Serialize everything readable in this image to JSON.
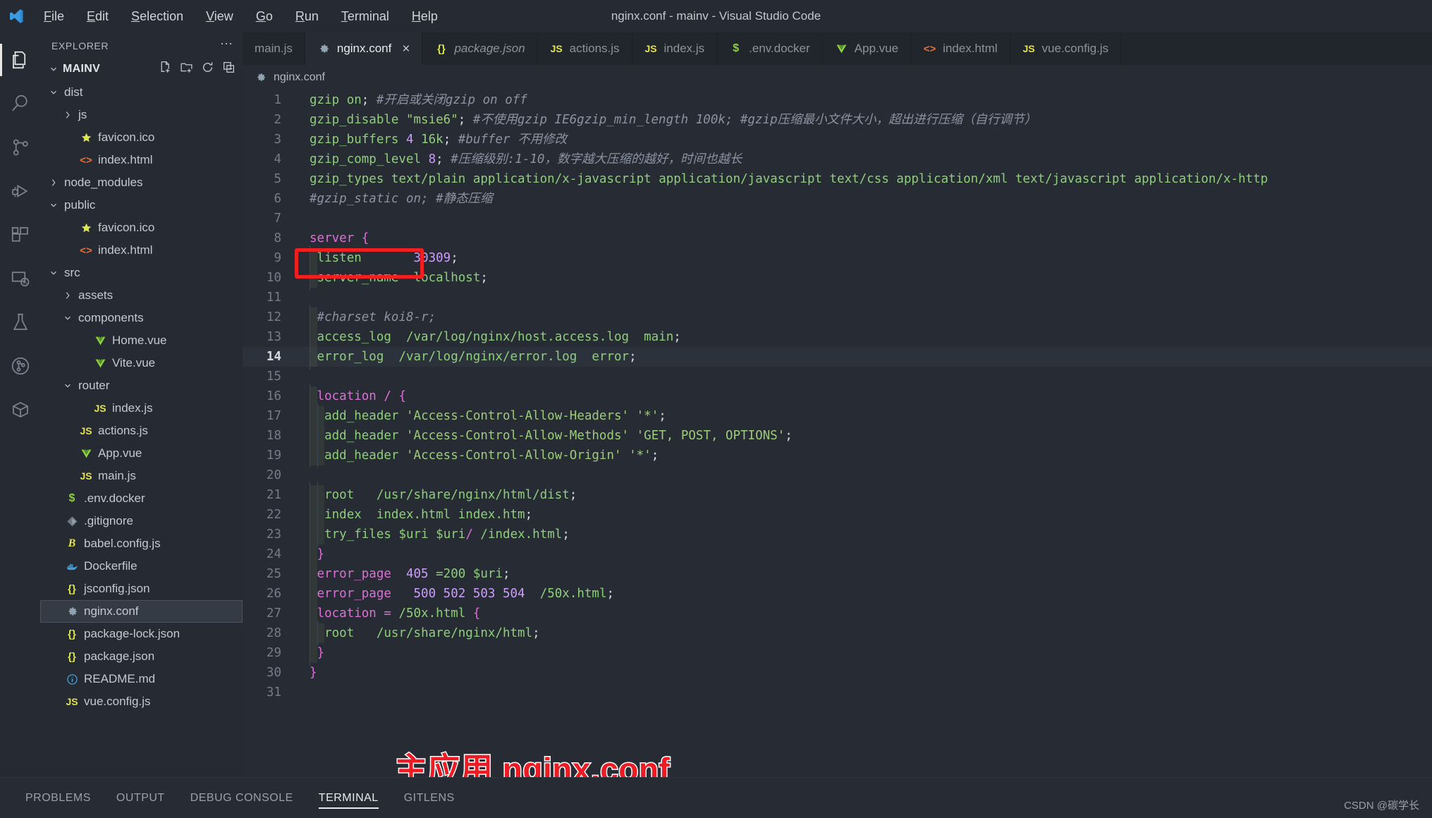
{
  "window": {
    "title": "nginx.conf - mainv - Visual Studio Code",
    "logo_icon": "vscode-logo-icon"
  },
  "menubar": {
    "items": [
      {
        "label": "File",
        "accel": "F"
      },
      {
        "label": "Edit",
        "accel": "E"
      },
      {
        "label": "Selection",
        "accel": "S"
      },
      {
        "label": "View",
        "accel": "V"
      },
      {
        "label": "Go",
        "accel": "G"
      },
      {
        "label": "Run",
        "accel": "R"
      },
      {
        "label": "Terminal",
        "accel": "T"
      },
      {
        "label": "Help",
        "accel": "H"
      }
    ]
  },
  "activitybar": {
    "items": [
      {
        "name": "explorer-icon",
        "label": "Explorer",
        "active": true
      },
      {
        "name": "search-icon",
        "label": "Search",
        "active": false
      },
      {
        "name": "source-control-icon",
        "label": "Source Control",
        "active": false
      },
      {
        "name": "run-debug-icon",
        "label": "Run and Debug",
        "active": false
      },
      {
        "name": "extensions-icon",
        "label": "Extensions",
        "active": false
      },
      {
        "name": "remote-explorer-icon",
        "label": "Remote Explorer",
        "active": false
      },
      {
        "name": "testing-icon",
        "label": "Testing",
        "active": false
      },
      {
        "name": "gitlens-icon",
        "label": "GitLens",
        "active": false
      },
      {
        "name": "package-icon",
        "label": "Package",
        "active": false
      }
    ]
  },
  "sidebar": {
    "title": "EXPLORER",
    "overflow_label": "⋯",
    "folder": "MAINV",
    "actions": [
      "new-file-icon",
      "new-folder-icon",
      "refresh-icon",
      "collapse-all-icon"
    ],
    "tree": [
      {
        "label": "dist",
        "indent": 1,
        "kind": "folder",
        "expanded": true
      },
      {
        "label": "js",
        "indent": 2,
        "kind": "folder",
        "expanded": false
      },
      {
        "label": "favicon.ico",
        "indent": 2,
        "kind": "file",
        "icon": "star-icon"
      },
      {
        "label": "index.html",
        "indent": 2,
        "kind": "file",
        "icon": "html-icon"
      },
      {
        "label": "node_modules",
        "indent": 1,
        "kind": "folder",
        "expanded": false
      },
      {
        "label": "public",
        "indent": 1,
        "kind": "folder",
        "expanded": true
      },
      {
        "label": "favicon.ico",
        "indent": 2,
        "kind": "file",
        "icon": "star-icon"
      },
      {
        "label": "index.html",
        "indent": 2,
        "kind": "file",
        "icon": "html-icon"
      },
      {
        "label": "src",
        "indent": 1,
        "kind": "folder",
        "expanded": true
      },
      {
        "label": "assets",
        "indent": 2,
        "kind": "folder",
        "expanded": false
      },
      {
        "label": "components",
        "indent": 2,
        "kind": "folder",
        "expanded": true
      },
      {
        "label": "Home.vue",
        "indent": 3,
        "kind": "file",
        "icon": "vue-icon"
      },
      {
        "label": "Vite.vue",
        "indent": 3,
        "kind": "file",
        "icon": "vue-icon"
      },
      {
        "label": "router",
        "indent": 2,
        "kind": "folder",
        "expanded": true
      },
      {
        "label": "index.js",
        "indent": 3,
        "kind": "file",
        "icon": "js-icon"
      },
      {
        "label": "actions.js",
        "indent": 2,
        "kind": "file",
        "icon": "js-icon"
      },
      {
        "label": "App.vue",
        "indent": 2,
        "kind": "file",
        "icon": "vue-icon"
      },
      {
        "label": "main.js",
        "indent": 2,
        "kind": "file",
        "icon": "js-icon"
      },
      {
        "label": ".env.docker",
        "indent": 1,
        "kind": "file",
        "icon": "dollar-icon"
      },
      {
        "label": ".gitignore",
        "indent": 1,
        "kind": "file",
        "icon": "git-icon"
      },
      {
        "label": "babel.config.js",
        "indent": 1,
        "kind": "file",
        "icon": "babel-icon"
      },
      {
        "label": "Dockerfile",
        "indent": 1,
        "kind": "file",
        "icon": "docker-icon"
      },
      {
        "label": "jsconfig.json",
        "indent": 1,
        "kind": "file",
        "icon": "json-icon"
      },
      {
        "label": "nginx.conf",
        "indent": 1,
        "kind": "file",
        "icon": "gear-icon",
        "selected": true
      },
      {
        "label": "package-lock.json",
        "indent": 1,
        "kind": "file",
        "icon": "json-icon"
      },
      {
        "label": "package.json",
        "indent": 1,
        "kind": "file",
        "icon": "json-icon"
      },
      {
        "label": "README.md",
        "indent": 1,
        "kind": "file",
        "icon": "info-icon"
      },
      {
        "label": "vue.config.js",
        "indent": 1,
        "kind": "file",
        "icon": "js-icon"
      }
    ]
  },
  "tabs": [
    {
      "label": "main.js",
      "icon": "none",
      "active": false,
      "italic": false,
      "close": false
    },
    {
      "label": "nginx.conf",
      "icon": "gear-icon",
      "active": true,
      "italic": false,
      "close": true,
      "close_label": "×"
    },
    {
      "label": "package.json",
      "icon": "json-icon",
      "active": false,
      "italic": true,
      "close": false
    },
    {
      "label": "actions.js",
      "icon": "js-icon",
      "active": false,
      "italic": false,
      "close": false
    },
    {
      "label": "index.js",
      "icon": "js-icon",
      "active": false,
      "italic": false,
      "close": false
    },
    {
      "label": ".env.docker",
      "icon": "dollar-icon",
      "active": false,
      "italic": false,
      "close": false
    },
    {
      "label": "App.vue",
      "icon": "vue-icon",
      "active": false,
      "italic": false,
      "close": false
    },
    {
      "label": "index.html",
      "icon": "html-icon",
      "active": false,
      "italic": false,
      "close": false
    },
    {
      "label": "vue.config.js",
      "icon": "js-icon",
      "active": false,
      "italic": false,
      "close": false
    }
  ],
  "breadcrumb": {
    "icon": "gear-icon",
    "label": "nginx.conf"
  },
  "editor": {
    "active_line": 14,
    "total_lines": 31,
    "lines": [
      {
        "n": 1,
        "text": "gzip on; #开启或关闭gzip on off"
      },
      {
        "n": 2,
        "text": "gzip_disable \"msie6\"; #不使用gzip IE6gzip_min_length 100k; #gzip压缩最小文件大小，超出进行压缩（自行调节）"
      },
      {
        "n": 3,
        "text": "gzip_buffers 4 16k; #buffer 不用修改"
      },
      {
        "n": 4,
        "text": "gzip_comp_level 8; #压缩级别:1-10，数字越大压缩的越好，时间也越长"
      },
      {
        "n": 5,
        "text": "gzip_types text/plain application/x-javascript application/javascript text/css application/xml text/javascript application/x-http"
      },
      {
        "n": 6,
        "text": "#gzip_static on; #静态压缩"
      },
      {
        "n": 7,
        "text": ""
      },
      {
        "n": 8,
        "text": "server {"
      },
      {
        "n": 9,
        "text": "    listen       30309;"
      },
      {
        "n": 10,
        "text": "    server_name  localhost;"
      },
      {
        "n": 11,
        "text": ""
      },
      {
        "n": 12,
        "text": "    #charset koi8-r;"
      },
      {
        "n": 13,
        "text": "    access_log  /var/log/nginx/host.access.log  main;"
      },
      {
        "n": 14,
        "text": "    error_log  /var/log/nginx/error.log  error;"
      },
      {
        "n": 15,
        "text": ""
      },
      {
        "n": 16,
        "text": "    location / {"
      },
      {
        "n": 17,
        "text": "      add_header 'Access-Control-Allow-Headers' '*';"
      },
      {
        "n": 18,
        "text": "      add_header 'Access-Control-Allow-Methods' 'GET, POST, OPTIONS';"
      },
      {
        "n": 19,
        "text": "      add_header 'Access-Control-Allow-Origin' '*';"
      },
      {
        "n": 20,
        "text": ""
      },
      {
        "n": 21,
        "text": "      root   /usr/share/nginx/html/dist;"
      },
      {
        "n": 22,
        "text": "      index  index.html index.htm;"
      },
      {
        "n": 23,
        "text": "      try_files $uri $uri/ /index.html;"
      },
      {
        "n": 24,
        "text": "    }"
      },
      {
        "n": 25,
        "text": "    error_page  405 =200 $uri;"
      },
      {
        "n": 26,
        "text": "    error_page   500 502 503 504  /50x.html;"
      },
      {
        "n": 27,
        "text": "    location = /50x.html {"
      },
      {
        "n": 28,
        "text": "      root   /usr/share/nginx/html;"
      },
      {
        "n": 29,
        "text": "    }"
      },
      {
        "n": 30,
        "text": "}"
      },
      {
        "n": 31,
        "text": ""
      }
    ]
  },
  "annotations": {
    "highlight_box": {
      "name": "listen-line-highlight",
      "color": "#f02020",
      "target_line": 9
    },
    "caption": {
      "text": "主应用 nginx.conf",
      "color": "#ed1c24"
    }
  },
  "panel": {
    "tabs": [
      {
        "label": "PROBLEMS",
        "active": false
      },
      {
        "label": "OUTPUT",
        "active": false
      },
      {
        "label": "DEBUG CONSOLE",
        "active": false
      },
      {
        "label": "TERMINAL",
        "active": true
      },
      {
        "label": "GITLENS",
        "active": false
      }
    ],
    "watermark": "CSDN @碳学长"
  }
}
